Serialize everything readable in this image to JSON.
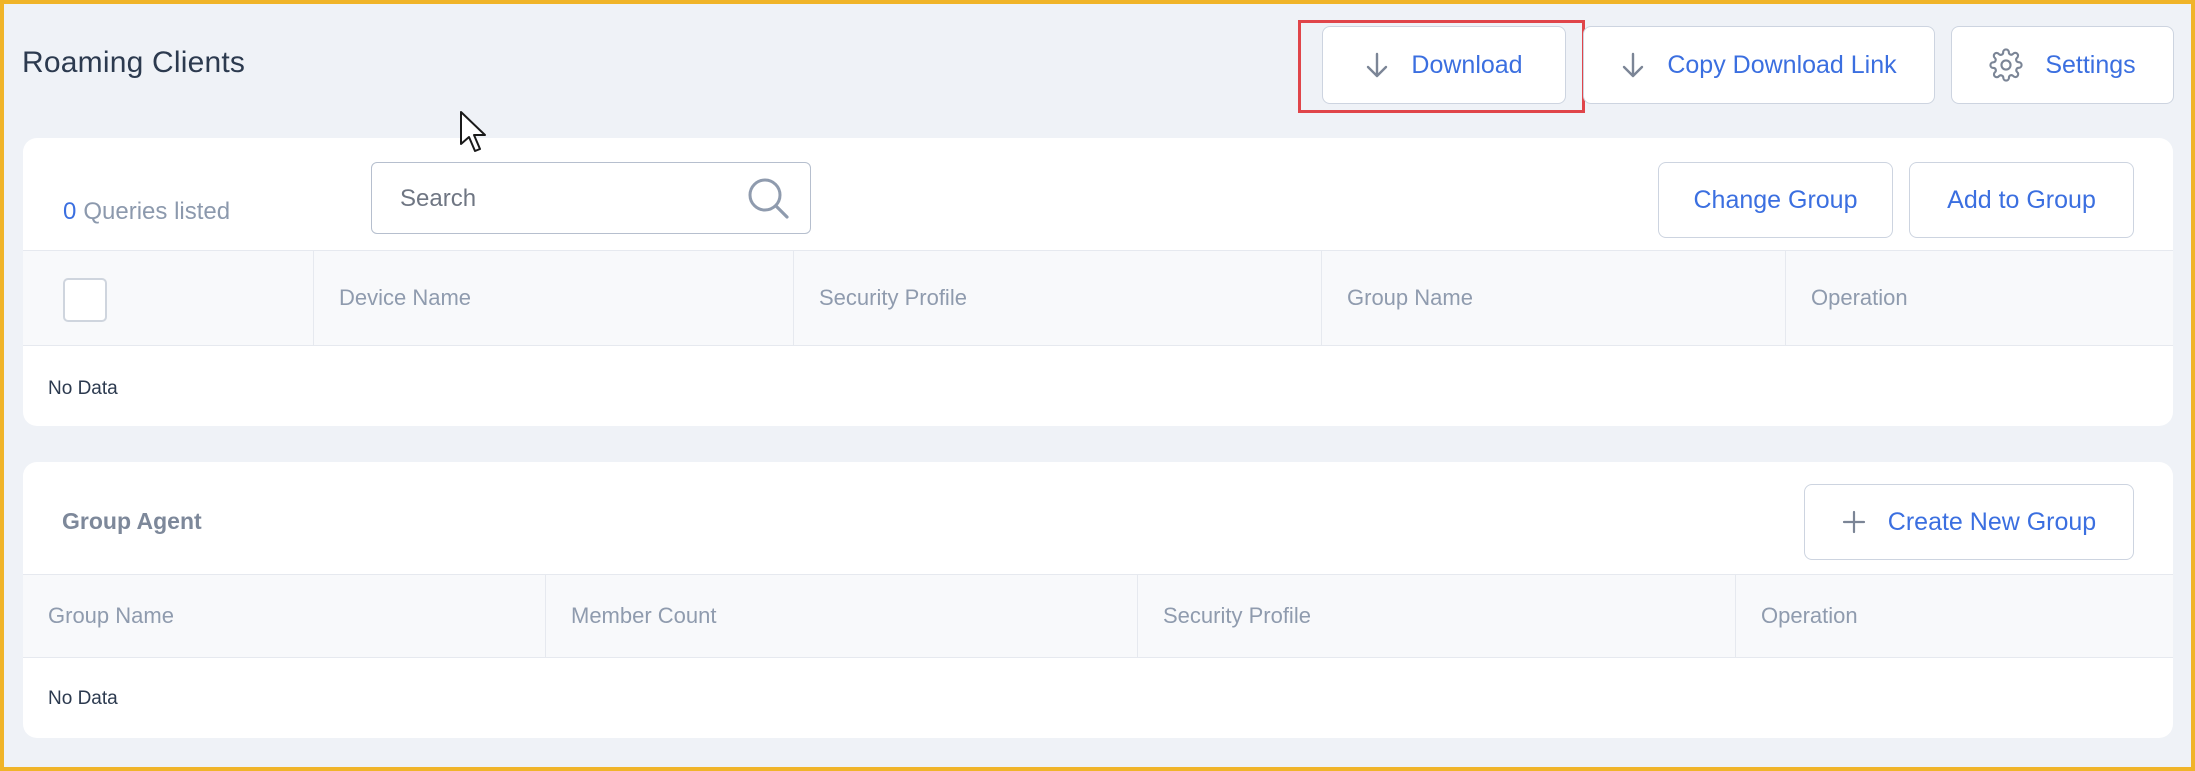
{
  "header": {
    "title": "Roaming Clients",
    "download_label": "Download",
    "copy_link_label": "Copy Download Link",
    "settings_label": "Settings"
  },
  "queries": {
    "count": "0",
    "count_suffix": "Queries listed",
    "search_placeholder": "Search",
    "change_group_label": "Change Group",
    "add_to_group_label": "Add to Group",
    "columns": [
      "Device Name",
      "Security Profile",
      "Group Name",
      "Operation"
    ],
    "empty_text": "No Data"
  },
  "group_agent": {
    "title": "Group Agent",
    "create_label": "Create New Group",
    "columns": [
      "Group Name",
      "Member Count",
      "Security Profile",
      "Operation"
    ],
    "empty_text": "No Data"
  },
  "colors": {
    "accent": "#3b6fe0",
    "page_border": "#f0b429",
    "highlight_border": "#e0454a",
    "background": "#eff2f7"
  },
  "icons": {
    "download": "arrow-down-icon",
    "copy_link": "arrow-down-icon",
    "settings": "gear-icon",
    "search": "search-icon",
    "create": "plus-icon",
    "cursor": "mouse-pointer-icon"
  }
}
